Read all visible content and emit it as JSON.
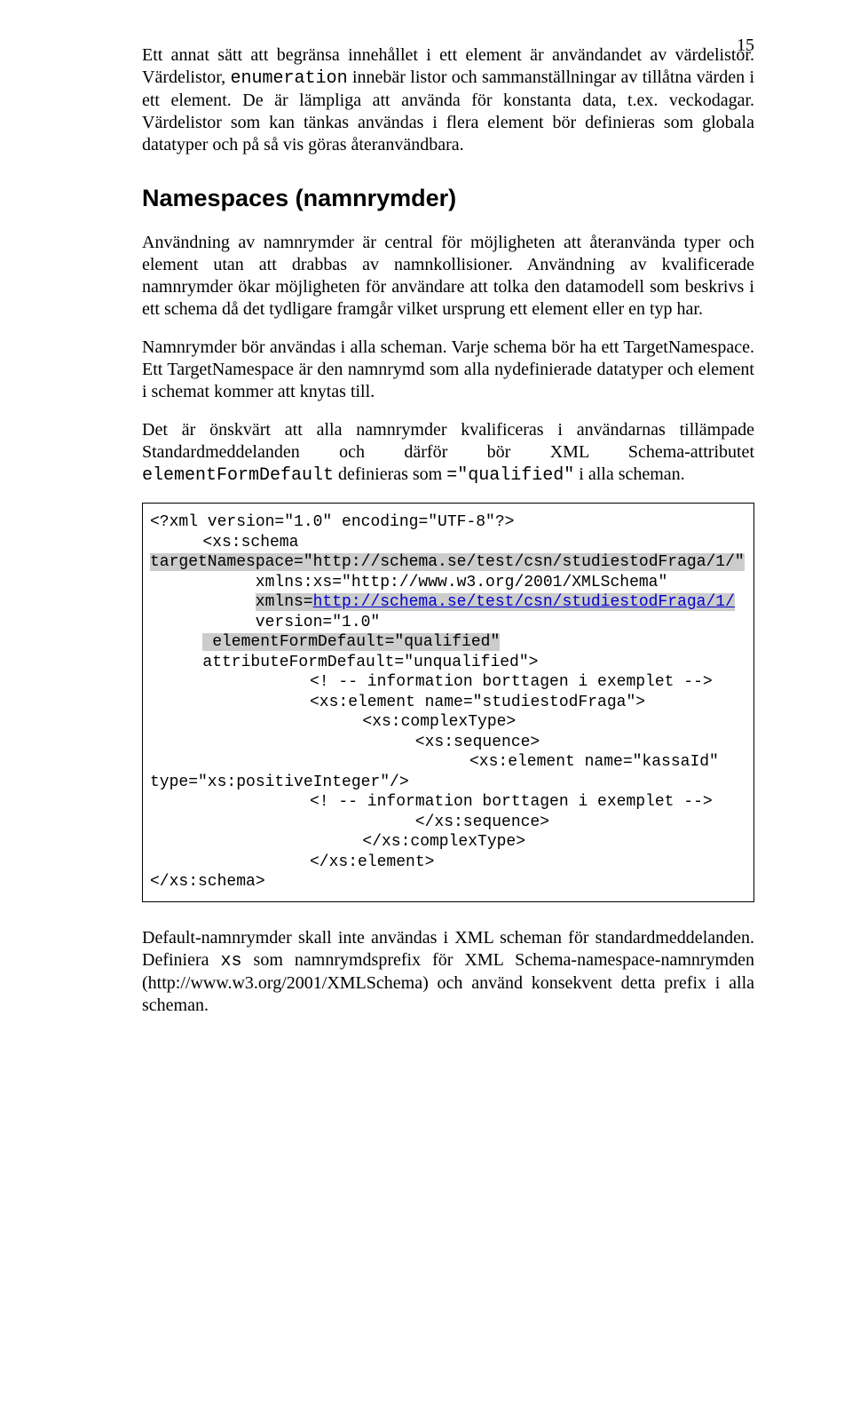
{
  "page_number": "15",
  "intro_para": {
    "t1": "Ett annat sätt att begränsa innehållet i ett element är användandet av värdelistor. Värdelistor, ",
    "t2_mono": "enumeration",
    "t3": " innebär listor och sammanställningar av tillåtna värden i ett element. De är lämpliga att använda för konstanta data, t.ex. veckodagar. Värdelistor som kan tänkas användas i flera element bör definieras som globala datatyper och på så vis göras återanvändbara."
  },
  "heading": "Namespaces (namnrymder)",
  "para2": "Användning av namnrymder är central för möjligheten att återanvända typer och element utan att drabbas av namnkollisioner. Användning av kvalificerade namnrymder ökar möjligheten för användare att tolka den datamodell som beskrivs i ett schema då det tydligare framgår vilket ursprung ett element eller en typ har.",
  "para3": "Namnrymder bör användas i alla scheman. Varje schema bör ha ett TargetNamespace. Ett TargetNamespace är den namnrymd som alla nydefinierade datatyper och element i schemat kommer att knytas till.",
  "para4": {
    "t1": "Det är önskvärt att alla namnrymder kvalificeras i användarnas tillämpade Standardmeddelanden och därför bör XML Schema-attributet ",
    "t2_mono": "elementFormDefault",
    "t3": " definieras som ",
    "t4_mono": "=\"qualified\"",
    "t5": " i alla scheman."
  },
  "code": {
    "l1": "<?xml version=\"1.0\" encoding=\"UTF-8\"?>",
    "l2": "<xs:schema",
    "l3_hl": "targetNamespace=\"http://schema.se/test/csn/studiestodFraga/1/\"",
    "l4": "xmlns:xs=\"http://www.w3.org/2001/XMLSchema\"",
    "l5a_hl": "xmlns=",
    "l5b_link": "http://schema.se/test/csn/studiestodFraga/1/",
    "l6": "version=\"1.0\"",
    "l7_hl": "elementFormDefault=\"qualified\"",
    "l8": "attributeFormDefault=\"unqualified\">",
    "l9": "<! -- information borttagen i exemplet -->",
    "l10": "<xs:element name=\"studiestodFraga\">",
    "l11": "<xs:complexType>",
    "l12": "<xs:sequence>",
    "l13": "<xs:element name=\"kassaId\"",
    "l14": "type=\"xs:positiveInteger\"/>",
    "l15": "<! -- information borttagen i exemplet -->",
    "l16": "</xs:sequence>",
    "l17": "</xs:complexType>",
    "l18": "</xs:element>",
    "l19": "</xs:schema>"
  },
  "para5": {
    "t1": "Default-namnrymder skall inte användas i XML scheman för standardmeddelanden. Definiera ",
    "t2_mono": "xs",
    "t3": " som namnrymdsprefix för XML Schema-namespace-namnrymden (http://www.w3.org/2001/XMLSchema) och använd konsekvent detta prefix i alla scheman."
  }
}
